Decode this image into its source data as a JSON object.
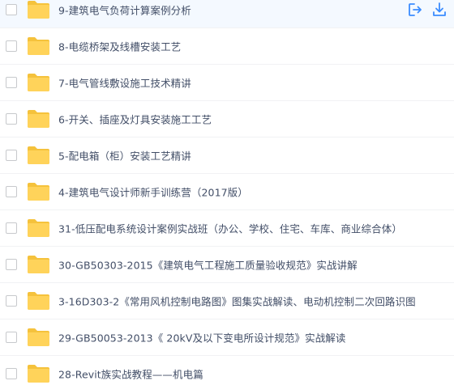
{
  "colors": {
    "folder": "#ffd35a",
    "folder_tab": "#f5c23c",
    "action_icon": "#3b8cff",
    "row_highlight": "#f4f9ff",
    "row_divider": "#f1f2f4"
  },
  "first_row_actions": [
    {
      "icon": "share-icon"
    },
    {
      "icon": "download-icon"
    }
  ],
  "files": [
    {
      "name": "9-建筑电气负荷计算案例分析",
      "icon": "folder-icon"
    },
    {
      "name": "8-电缆桥架及线槽安装工艺",
      "icon": "folder-icon"
    },
    {
      "name": "7-电气管线敷设施工技术精讲",
      "icon": "folder-icon"
    },
    {
      "name": "6-开关、插座及灯具安装施工工艺",
      "icon": "folder-icon"
    },
    {
      "name": "5-配电箱（柜）安装工艺精讲",
      "icon": "folder-icon"
    },
    {
      "name": "4-建筑电气设计师新手训练营（2017版）",
      "icon": "folder-icon"
    },
    {
      "name": "31-低压配电系统设计案例实战班（办公、学校、住宅、车库、商业综合体）",
      "icon": "folder-icon"
    },
    {
      "name": "30-GB50303-2015《建筑电气工程施工质量验收规范》实战讲解",
      "icon": "folder-icon"
    },
    {
      "name": "3-16D303-2《常用风机控制电路图》图集实战解读、电动机控制二次回路识图",
      "icon": "folder-icon"
    },
    {
      "name": "29-GB50053-2013《 20kV及以下变电所设计规范》实战解读",
      "icon": "folder-icon"
    },
    {
      "name": "28-Revit族实战教程——机电篇",
      "icon": "folder-icon"
    }
  ]
}
